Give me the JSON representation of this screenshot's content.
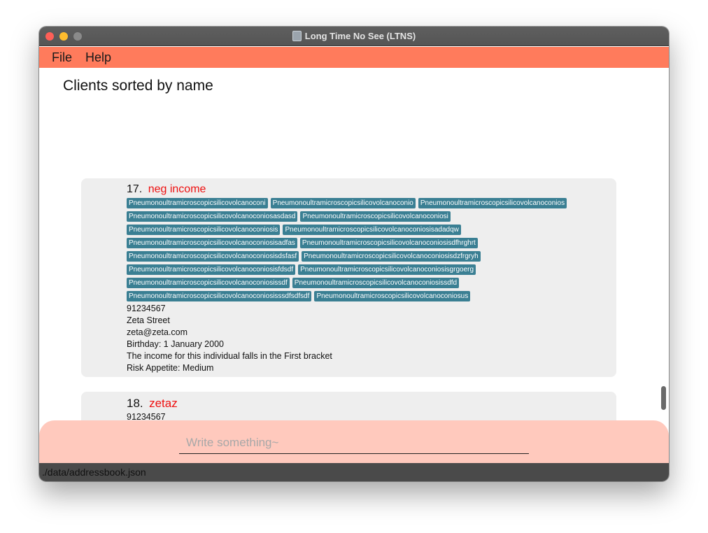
{
  "window": {
    "title": "Long Time No See (LTNS)"
  },
  "menu": {
    "file": "File",
    "help": "Help"
  },
  "heading": "Clients sorted by name",
  "clients": [
    {
      "index": "17.",
      "name": "neg income",
      "tag_rows": [
        [
          "Pneumonoultramicroscopicsilicovolcanoconi",
          "Pneumonoultramicroscopicsilicovolcanoconio",
          "Pneumonoultramicroscopicsilicovolcanoconios"
        ],
        [
          "Pneumonoultramicroscopicsilicovolcanoconiosasdasd",
          "Pneumonoultramicroscopicsilicovolcanoconiosi"
        ],
        [
          "Pneumonoultramicroscopicsilicovolcanoconiosis",
          "Pneumonoultramicroscopicsilicovolcanoconiosisadadqw"
        ],
        [
          "Pneumonoultramicroscopicsilicovolcanoconiosisadfas",
          "Pneumonoultramicroscopicsilicovolcanoconiosisdfhrghrt"
        ],
        [
          "Pneumonoultramicroscopicsilicovolcanoconiosisdsfasf",
          "Pneumonoultramicroscopicsilicovolcanoconiosisdzfrgryh"
        ],
        [
          "Pneumonoultramicroscopicsilicovolcanoconiosisfdsdf",
          "Pneumonoultramicroscopicsilicovolcanoconiosisgrgoerg"
        ],
        [
          "Pneumonoultramicroscopicsilicovolcanoconiosissdf",
          "Pneumonoultramicroscopicsilicovolcanoconiosissdfd"
        ],
        [
          "Pneumonoultramicroscopicsilicovolcanoconiosisssdfsdfsdf",
          "Pneumonoultramicroscopicsilicovolcanoconiosus"
        ]
      ],
      "phone": "91234567",
      "address": "Zeta Street",
      "email": "zeta@zeta.com",
      "birthday": "Birthday: 1 January 2000",
      "income": "The income for this individual falls in the First bracket",
      "risk": "Risk Appetite: Medium"
    },
    {
      "index": "18.",
      "name": "zetaz",
      "phone": "91234567"
    }
  ],
  "command": {
    "placeholder": "Write something~",
    "value": ""
  },
  "status": {
    "path": "./data/addressbook.json"
  }
}
